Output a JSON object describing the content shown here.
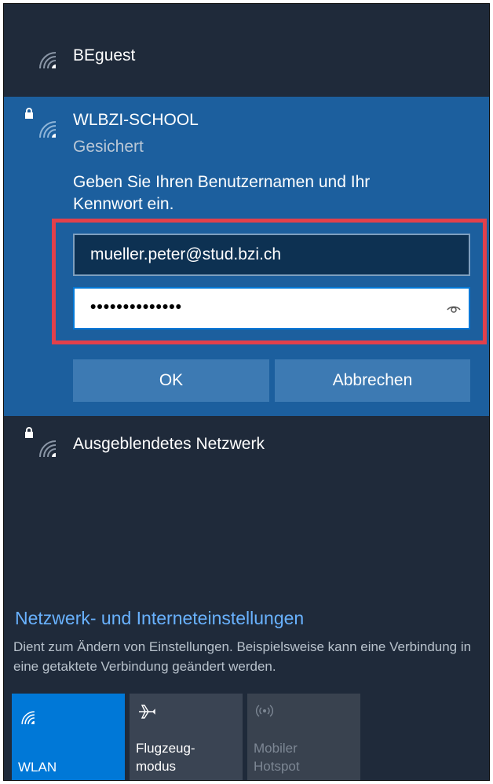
{
  "networks": {
    "guest": {
      "name": "BEguest"
    },
    "selected": {
      "name": "WLBZI-SCHOOL",
      "status": "Gesichert",
      "prompt": "Geben Sie Ihren Benutzernamen und Ihr Kennwort ein.",
      "username_value": "mueller.peter@stud.bzi.ch",
      "password_mask": "••••••••••••••",
      "ok_label": "OK",
      "cancel_label": "Abbrechen"
    },
    "hidden": {
      "name": "Ausgeblendetes Netzwerk"
    }
  },
  "settings": {
    "title": "Netzwerk- und Interneteinstellungen",
    "description": "Dient zum Ändern von Einstellungen. Beispielsweise kann eine Verbindung in eine getaktete Verbindung geändert werden."
  },
  "quick_actions": [
    {
      "label": "WLAN",
      "icon": "wifi-icon",
      "state": "active"
    },
    {
      "label": "Flugzeug-\nmodus",
      "icon": "airplane-icon",
      "state": "inactive"
    },
    {
      "label": "Mobiler\nHotspot",
      "icon": "hotspot-icon",
      "state": "disabled"
    }
  ],
  "colors": {
    "panel_bg": "#1f2a3a",
    "selected_bg": "#1c5f9e",
    "accent": "#0078d7",
    "link": "#69b2ff",
    "highlight_border": "#e2404b"
  }
}
